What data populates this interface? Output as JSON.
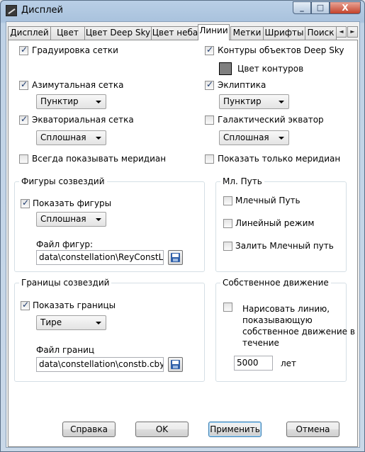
{
  "window": {
    "title": "Дисплей"
  },
  "caption_buttons": {
    "minimize": "_",
    "maximize": "□",
    "close": "X"
  },
  "tabs": [
    {
      "label": "Дисплей"
    },
    {
      "label": "Цвет"
    },
    {
      "label": "Цвет Deep Sky"
    },
    {
      "label": "Цвет неба"
    },
    {
      "label": "Линии"
    },
    {
      "label": "Метки"
    },
    {
      "label": "Шрифты"
    },
    {
      "label": "Поиск"
    }
  ],
  "tab_scroll": {
    "left": "◄",
    "right": "►"
  },
  "left": {
    "grid": {
      "label": "Градуировка сетки",
      "checked": true
    },
    "azimuthal": {
      "label": "Азимутальная сетка",
      "checked": true,
      "style": "Пунктир"
    },
    "equatorial": {
      "label": "Экваториальная сетка",
      "checked": true,
      "style": "Сплошная"
    },
    "meridians": {
      "label": "Всегда показывать меридиан",
      "checked": false
    }
  },
  "right": {
    "deepsky_outlines": {
      "label": "Контуры объектов Deep Sky",
      "checked": true
    },
    "outline_color": {
      "label": "Цвет контуров",
      "color": "#7f7f7f"
    },
    "ecliptic": {
      "label": "Эклиптика",
      "checked": true,
      "style": "Пунктир"
    },
    "galactic": {
      "label": "Галактический экватор",
      "checked": false,
      "style": "Сплошная"
    },
    "only_meridian": {
      "label": "Показать только меридиан",
      "checked": false
    }
  },
  "constellation_figures": {
    "title": "Фигуры созвездий",
    "show": {
      "label": "Показать фигуры",
      "checked": true
    },
    "style": "Сплошная",
    "file_label": "Файл фигур:",
    "file_value": "data\\constellation\\ReyConstL.cln"
  },
  "milky_way": {
    "title": "Мл. Путь",
    "milky": {
      "label": "Млечный Путь",
      "checked": false
    },
    "linear": {
      "label": "Линейный режим",
      "checked": false
    },
    "fill": {
      "label": "Залить Млечный путь",
      "checked": false
    }
  },
  "constellation_bounds": {
    "title": "Границы созвездий",
    "show": {
      "label": "Показать границы",
      "checked": true
    },
    "style": "Тире",
    "file_label": "Файл границ",
    "file_value": "data\\constellation\\constb.cby"
  },
  "proper_motion": {
    "title": "Собственное движение",
    "draw": {
      "label_lines": [
        "Нарисовать линию,",
        "показывающую",
        "собственное движение в",
        "течение"
      ],
      "checked": false
    },
    "years_value": "5000",
    "years_unit": "лет"
  },
  "buttons": {
    "help": "Справка",
    "ok": "OK",
    "apply": "Применить",
    "cancel": "Отмена"
  }
}
